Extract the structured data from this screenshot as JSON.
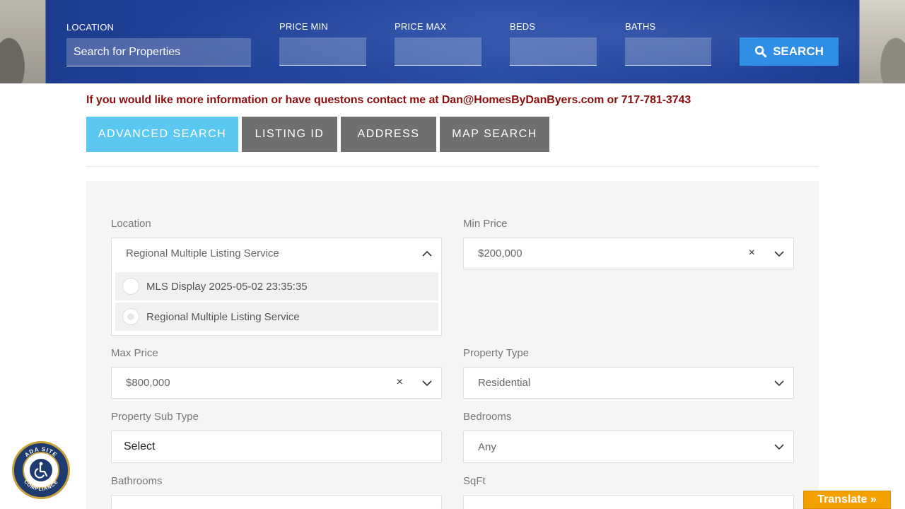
{
  "hero": {
    "location_label": "LOCATION",
    "location_placeholder": "Search for Properties",
    "price_min_label": "PRICE MIN",
    "price_max_label": "PRICE MAX",
    "beds_label": "BEDS",
    "baths_label": "BATHS",
    "search_label": "SEARCH",
    "search_icon": "search-icon"
  },
  "contact": {
    "text": "If you would like more information or have questons contact me at Dan@HomesByDanByers.com or 717-781-3743"
  },
  "tabs": [
    {
      "label": "ADVANCED SEARCH",
      "active": true
    },
    {
      "label": "LISTING ID",
      "active": false
    },
    {
      "label": "ADDRESS",
      "active": false
    },
    {
      "label": "MAP SEARCH",
      "active": false
    }
  ],
  "form": {
    "location": {
      "label": "Location",
      "value": "Regional Multiple Listing Service"
    },
    "location_options": [
      {
        "label": "MLS Display 2025-05-02 23:35:35",
        "selected": false
      },
      {
        "label": "Regional Multiple Listing Service",
        "selected": true
      }
    ],
    "min_price": {
      "label": "Min Price",
      "value": "$200,000",
      "clear": "×"
    },
    "max_price": {
      "label": "Max Price",
      "value": "$800,000",
      "clear": "×"
    },
    "property_type": {
      "label": "Property Type",
      "value": "Residential"
    },
    "property_sub_type": {
      "label": "Property Sub Type",
      "value": "Select"
    },
    "bedrooms": {
      "label": "Bedrooms",
      "value": "Any"
    },
    "bathrooms": {
      "label": "Bathrooms",
      "value": ""
    },
    "sqft": {
      "label": "SqFt",
      "value": ""
    }
  },
  "ada": {
    "top_text": "ADA SITE",
    "bottom_text": "COMPLIANCE"
  },
  "translate": {
    "label": "Translate »"
  },
  "colors": {
    "active_tab": "#5bc8f2",
    "inactive_tab": "#6f6f6f",
    "search_button": "#2f8fe6",
    "contact_text": "#8b0f0f",
    "translate": "#f4a100"
  }
}
